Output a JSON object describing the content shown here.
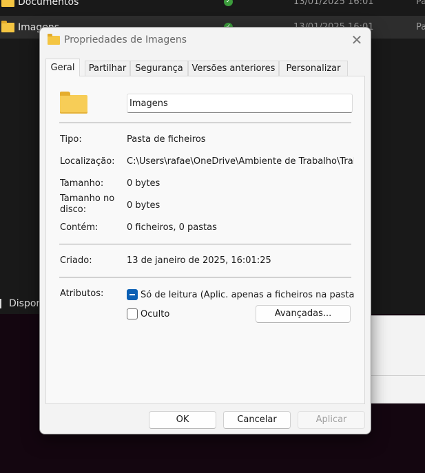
{
  "explorer": {
    "rows": [
      {
        "name": "Documentos",
        "date": "13/01/2025 16:01",
        "type": "Pa"
      },
      {
        "name": "Imagens",
        "date": "13/01/2025 16:01",
        "type": "Pa"
      }
    ],
    "status_text": "Dispor"
  },
  "dialog": {
    "title": "Propriedades de Imagens",
    "close_label": "✕",
    "tabs": [
      "Geral",
      "Partilhar",
      "Segurança",
      "Versões anteriores",
      "Personalizar"
    ],
    "active_tab": "Geral",
    "name_value": "Imagens",
    "fields": {
      "tipo_label": "Tipo:",
      "tipo_value": "Pasta de ficheiros",
      "localizacao_label": "Localização:",
      "localizacao_value": "C:\\Users\\rafae\\OneDrive\\Ambiente de Trabalho\\Traba",
      "tamanho_label": "Tamanho:",
      "tamanho_value": "0 bytes",
      "tamanho_disco_label": "Tamanho no disco:",
      "tamanho_disco_value": "0 bytes",
      "contem_label": "Contém:",
      "contem_value": "0 ficheiros, 0 pastas",
      "criado_label": "Criado:",
      "criado_value": "13 de janeiro de 2025, 16:01:25"
    },
    "attributes": {
      "label": "Atributos:",
      "readonly_label": "Só de leitura (Aplic. apenas a ficheiros na pasta)",
      "readonly_state": "indeterminate",
      "hidden_label": "Oculto",
      "hidden_state": "unchecked",
      "advanced_button": "Avançadas..."
    },
    "buttons": {
      "ok": "OK",
      "cancel": "Cancelar",
      "apply": "Aplicar"
    }
  },
  "colors": {
    "accent": "#0a5fb4",
    "folder": "#f4c542",
    "dialog_bg": "#f3f3f3",
    "explorer_bg": "#191919"
  }
}
